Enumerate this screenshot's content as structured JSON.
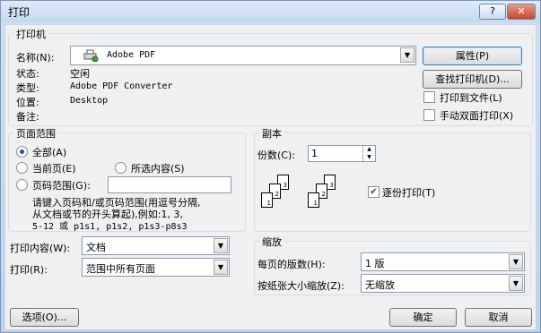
{
  "window": {
    "title": "打印",
    "help_label": "?",
    "close_label": "✕"
  },
  "printer": {
    "group_label": "打印机",
    "name_label": "名称(N):",
    "name_value": "Adobe PDF",
    "status_label": "状态:",
    "status_value": "空闲",
    "type_label": "类型:",
    "type_value": "Adobe PDF Converter",
    "where_label": "位置:",
    "where_value": "Desktop",
    "comment_label": "备注:",
    "properties_button": "属性(P)",
    "find_button": "查找打印机(D)...",
    "print_to_file_label": "打印到文件(L)",
    "manual_duplex_label": "手动双面打印(X)"
  },
  "page_range": {
    "group_label": "页面范围",
    "all_label": "全部(A)",
    "current_label": "当前页(E)",
    "selection_label": "所选内容(S)",
    "pages_label": "页码范围(G):",
    "pages_value": "",
    "hint_line1": "请键入页码和/或页码范围(用逗号分隔,",
    "hint_line2": "从文档或节的开头算起),例如:1, 3,",
    "hint_line3": "5-12 或 p1s1, p1s2, p1s3-p8s3"
  },
  "copies": {
    "group_label": "副本",
    "count_label": "份数(C):",
    "count_value": "1",
    "collate_label": "逐份打印(T)",
    "stack1": [
      "3",
      "2",
      "1"
    ],
    "stack2": [
      "3",
      "2",
      "1"
    ]
  },
  "print_what": {
    "label": "打印内容(W):",
    "value": "文档"
  },
  "print": {
    "label": "打印(R):",
    "value": "范围中所有页面"
  },
  "zoom": {
    "group_label": "缩放",
    "pages_per_sheet_label": "每页的版数(H):",
    "pages_per_sheet_value": "1 版",
    "scale_label": "按纸张大小缩放(Z):",
    "scale_value": "无缩放"
  },
  "footer": {
    "options_button": "选项(O)...",
    "ok_button": "确定",
    "cancel_button": "取消"
  }
}
